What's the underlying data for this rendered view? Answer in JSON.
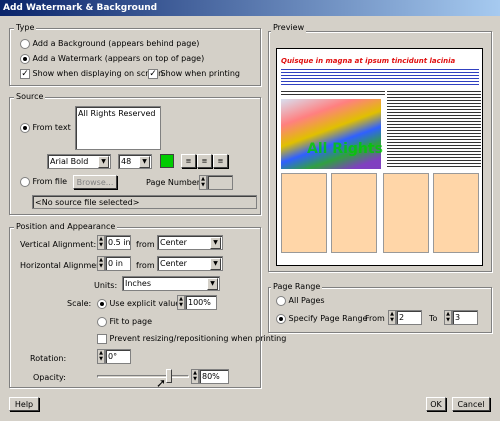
{
  "window": {
    "title": "Add Watermark & Background"
  },
  "type_group": {
    "legend": "Type",
    "add_background": "Add a Background (appears behind page)",
    "add_watermark": "Add a Watermark (appears on top of page)",
    "show_on_screen": "Show when displaying on screen",
    "show_printing": "Show when printing"
  },
  "source_group": {
    "legend": "Source",
    "from_text": "From text",
    "text_value": "All Rights Reserved",
    "font": "Arial Bold",
    "size": "48",
    "color": "#00cc00",
    "from_file": "From file",
    "browse": "Browse...",
    "page_number": "Page Number:",
    "no_file": "<No source file selected>"
  },
  "position_group": {
    "legend": "Position and Appearance",
    "vertical_label": "Vertical Alignment:",
    "vertical_value": "0.5 in",
    "vertical_from": "from",
    "vertical_anchor": "Center",
    "horizontal_label": "Horizontal Alignment:",
    "horizontal_value": "0 in",
    "horizontal_from": "from",
    "horizontal_anchor": "Center",
    "units_label": "Units:",
    "units_value": "Inches",
    "scale_label": "Scale:",
    "use_explicit": "Use explicit value",
    "scale_value": "100%",
    "fit_to_page": "Fit to page",
    "prevent_resizing": "Prevent resizing/repositioning when printing",
    "rotation_label": "Rotation:",
    "rotation_value": "0°",
    "opacity_label": "Opacity:",
    "opacity_value": "80%",
    "opacity_level": 0.8
  },
  "preview": {
    "legend": "Preview",
    "headline": "Quisque in magna at ipsum tincidunt lacinia",
    "watermark": "All Rights",
    "filler": "Fusce arcu. Suspendisse accumsan elit. Nam in luctus. Quisque sit amet lorem ipsum."
  },
  "page_range": {
    "legend": "Page Range",
    "all_pages": "All Pages",
    "specify": "Specify Page Range",
    "from_label": "From",
    "from_value": "2",
    "to_label": "To",
    "to_value": "3"
  },
  "footer": {
    "help": "Help",
    "ok": "OK",
    "cancel": "Cancel"
  }
}
